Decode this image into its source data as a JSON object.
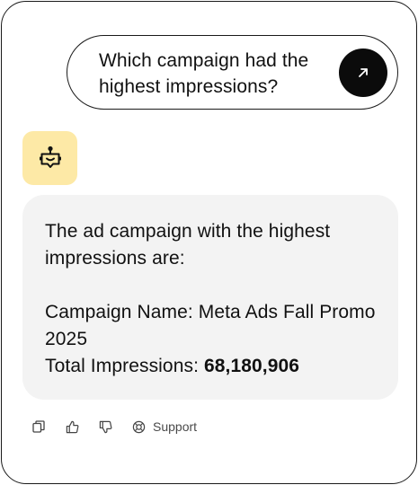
{
  "user_message": {
    "text": "Which campaign had the highest impressions?"
  },
  "send_button": {
    "icon": "arrow-up-right-icon",
    "background": "#0b0b0b"
  },
  "bot": {
    "avatar_icon": "robot-icon",
    "avatar_background": "#fde9a6"
  },
  "answer": {
    "intro": "The ad campaign with the highest impressions are:",
    "campaign_line": "Campaign Name: Meta Ads Fall Promo 2025",
    "impressions_label": "Total Impressions:",
    "impressions_value": "68,180,906",
    "background": "#f3f3f3"
  },
  "actions": {
    "copy_icon": "copy-icon",
    "thumbs_up_icon": "thumbs-up-icon",
    "thumbs_down_icon": "thumbs-down-icon",
    "support_icon": "lifebuoy-icon",
    "support_label": "Support"
  }
}
